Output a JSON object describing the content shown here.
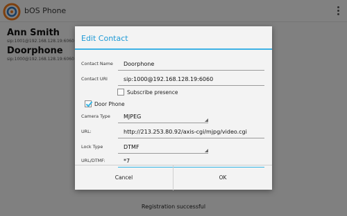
{
  "app": {
    "title": "bOS Phone"
  },
  "contacts": [
    {
      "name": "Ann Smith",
      "uri": "sip:1001@192.168.128.19:6060"
    },
    {
      "name": "Doorphone",
      "uri": "sip:1000@192.168.128.19:6060"
    }
  ],
  "status": "Registration successful",
  "dialog": {
    "title": "Edit Contact",
    "contact_name_label": "Contact Name",
    "contact_name_value": "Doorphone",
    "contact_uri_label": "Contact URI",
    "contact_uri_value": "sip:1000@192.168.128.19:6060",
    "subscribe_label": "Subscribe presence",
    "subscribe_checked": false,
    "door_phone_label": "Door Phone",
    "door_phone_checked": true,
    "camera_type_label": "Camera Type",
    "camera_type_value": "MJPEG",
    "url_label": "URL:",
    "url_value": "http://213.253.80.92/axis-cgi/mjpg/video.cgi",
    "lock_type_label": "Lock Type",
    "lock_type_value": "DTMF",
    "url_dtmf_label": "URL/DTMF:",
    "url_dtmf_value": "*7",
    "cancel_label": "Cancel",
    "ok_label": "OK"
  },
  "colors": {
    "accent": "#33b5e5",
    "title": "#1e9ad6"
  },
  "icons": {
    "logo": "app-logo-icon",
    "overflow": "overflow-menu-icon"
  }
}
